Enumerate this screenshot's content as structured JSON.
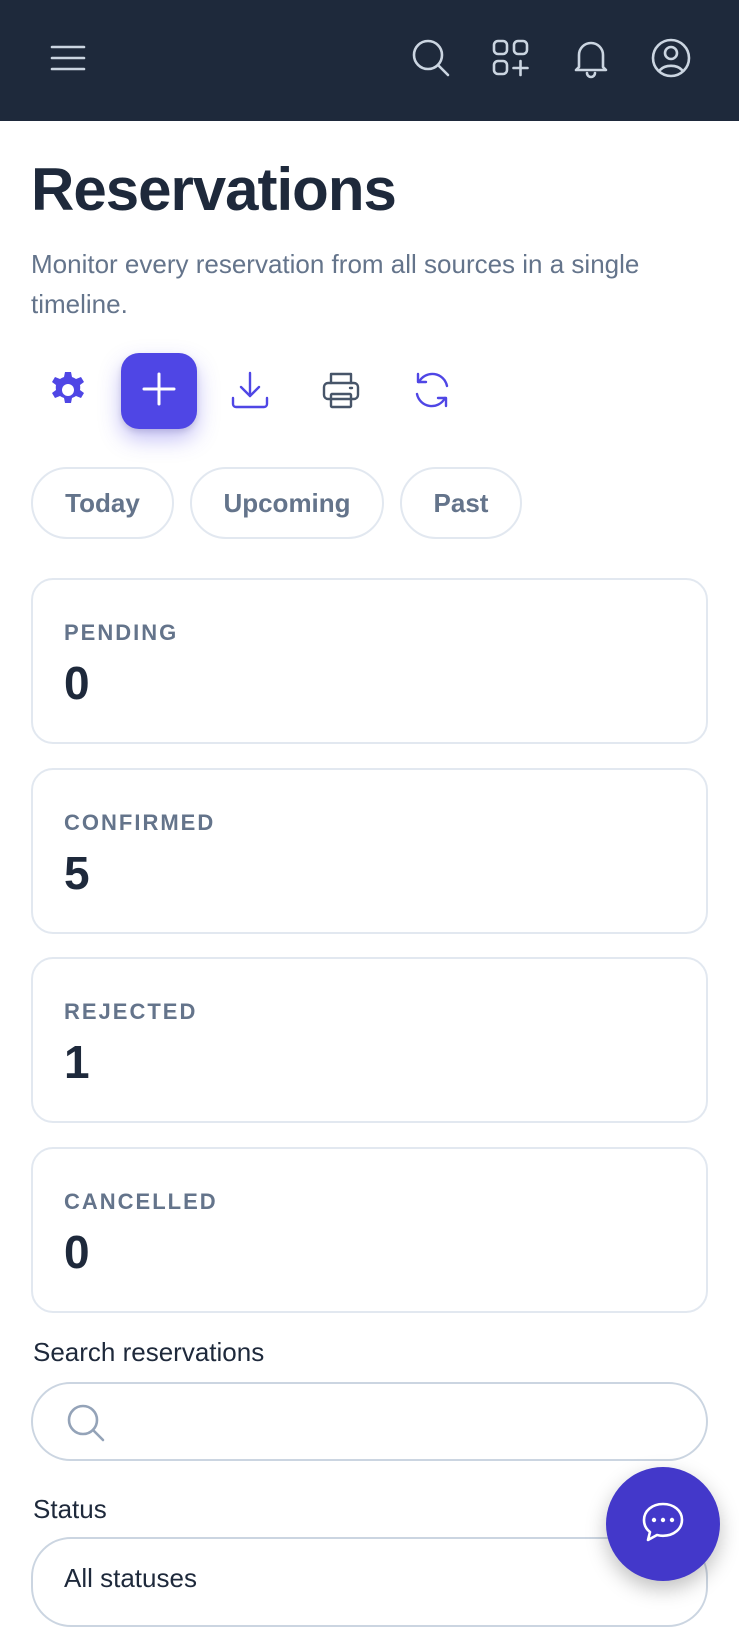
{
  "header": {
    "icons": [
      "menu-icon",
      "search-icon",
      "apps-add-icon",
      "bell-icon",
      "user-circle-icon"
    ]
  },
  "page": {
    "title": "Reservations",
    "description": "Monitor every reservation from all sources in a single timeline."
  },
  "toolbar": {
    "icons": [
      "gear-icon",
      "plus-icon",
      "download-icon",
      "printer-icon",
      "refresh-icon"
    ],
    "accent_color": "#4f46e5"
  },
  "filters": {
    "today": "Today",
    "upcoming": "Upcoming",
    "past": "Past"
  },
  "stats": [
    {
      "label": "PENDING",
      "value": "0"
    },
    {
      "label": "CONFIRMED",
      "value": "5"
    },
    {
      "label": "REJECTED",
      "value": "1"
    },
    {
      "label": "CANCELLED",
      "value": "0"
    }
  ],
  "search": {
    "label": "Search reservations",
    "value": "",
    "placeholder": ""
  },
  "status": {
    "label": "Status",
    "selected": "All statuses"
  },
  "chat": {
    "icon": "chat-bubble-icon",
    "color": "#4338ca"
  },
  "colors": {
    "header_bg": "#1e293b",
    "title_text": "#1e293b",
    "muted_text": "#64748b"
  }
}
